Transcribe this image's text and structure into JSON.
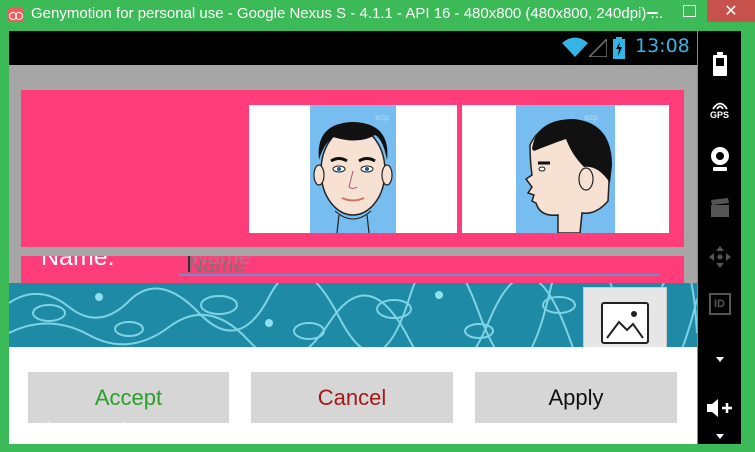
{
  "window": {
    "title": "Genymotion for personal use - Google Nexus S - 4.1.1 - API 16 - 480x800 (480x800, 240dpi) ...",
    "close_glyph": "✕"
  },
  "statusbar": {
    "time": "13:08"
  },
  "form": {
    "name_label": "Name:",
    "name_placeholder": "Name",
    "name_value": "Name"
  },
  "photos": {
    "front_watermark": "ezp",
    "side_watermark": "ezp"
  },
  "buttons": {
    "accept": "Accept",
    "cancel": "Cancel",
    "apply": "Apply"
  },
  "sidebar": {
    "items": [
      {
        "icon": "battery-icon"
      },
      {
        "icon": "gps-icon",
        "label": "GPS"
      },
      {
        "icon": "webcam-icon"
      },
      {
        "icon": "clapperboard-icon"
      },
      {
        "icon": "dpad-icon"
      },
      {
        "icon": "id-icon",
        "label": "ID"
      },
      {
        "icon": "volume-up-icon"
      }
    ]
  },
  "footer": {
    "watermark": "free for personal use"
  },
  "colors": {
    "window_green": "#3bba57",
    "card_pink": "#ff3d7b",
    "accept_green": "#2aa02a",
    "cancel_red": "#a41818",
    "clock_blue": "#33b5e5"
  }
}
